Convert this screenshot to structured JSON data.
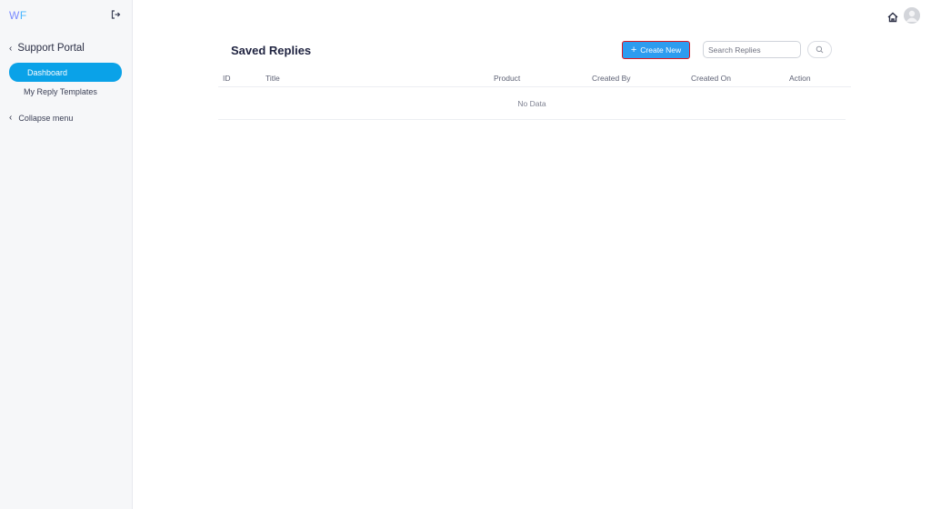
{
  "sidebar": {
    "logo_w": "W",
    "logo_f": "F",
    "back_label": "Support Portal",
    "items": [
      {
        "label": "Dashboard",
        "active": true
      },
      {
        "label": "My Reply Templates",
        "active": false
      }
    ],
    "collapse_label": "Collapse menu"
  },
  "main": {
    "title": "Saved Replies",
    "create_button": "Create New",
    "search_placeholder": "Search Replies",
    "search_value": ""
  },
  "table": {
    "columns": [
      "ID",
      "Title",
      "Product",
      "Created By",
      "Created On",
      "Action"
    ],
    "empty_text": "No Data"
  },
  "colors": {
    "accent": "#0aa2e8",
    "button": "#2d9cf0",
    "highlight_border": "#e0161c"
  },
  "icons": [
    "logout-icon",
    "chevron-left-icon",
    "home-icon",
    "user-avatar-icon",
    "search-icon",
    "plus-icon"
  ]
}
